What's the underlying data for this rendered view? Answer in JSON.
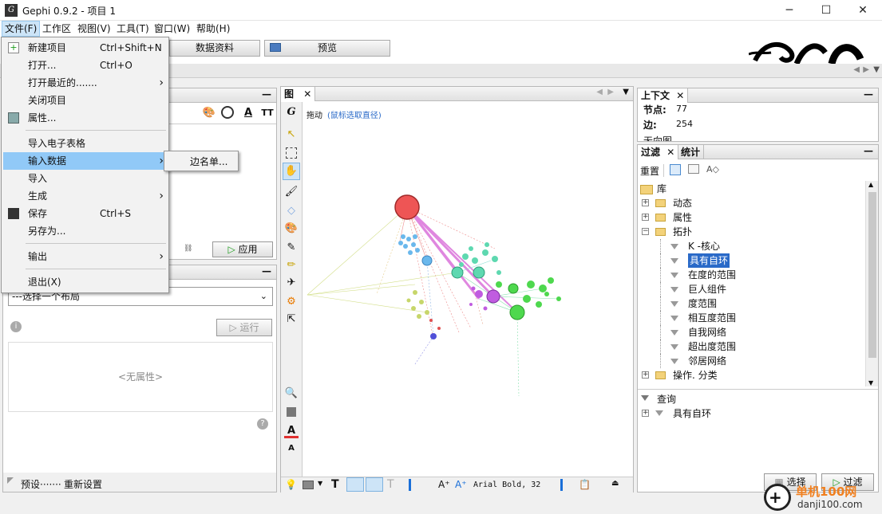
{
  "window": {
    "title": "Gephi 0.9.2 - 项目 1",
    "minimize": "─",
    "maximize": "☐",
    "close": "✕"
  },
  "menubar": [
    "文件(F)",
    "工作区",
    "视图(V)",
    "工具(T)",
    "窗口(W)",
    "帮助(H)"
  ],
  "modes": {
    "data_lab": "数据资料",
    "preview": "预览"
  },
  "file_menu": {
    "items": [
      {
        "label": "新建项目",
        "shortcut": "Ctrl+Shift+N",
        "icon": "new-project-icon"
      },
      {
        "label": "打开...",
        "shortcut": "Ctrl+O"
      },
      {
        "label": "打开最近的.......",
        "submenu": true
      },
      {
        "label": "关闭项目"
      },
      {
        "label": "属性...",
        "icon": "properties-icon"
      },
      {
        "label": "导入电子表格"
      },
      {
        "label": "输入数据",
        "submenu": true,
        "highlighted": true
      },
      {
        "label": "导入"
      },
      {
        "label": "生成",
        "submenu": true
      },
      {
        "label": "保存",
        "shortcut": "Ctrl+S",
        "icon": "save-icon"
      },
      {
        "label": "另存为..."
      },
      {
        "label": "输出",
        "submenu": true
      },
      {
        "label": "退出(X)"
      }
    ],
    "submenu_item": "边名单..."
  },
  "left_panel": {
    "apply_button": "应用",
    "layout_select": "---选择一个布局",
    "run_button": "运行",
    "no_properties": "<无属性>",
    "presets": "预设·······",
    "reset": "重新设置"
  },
  "graph_panel": {
    "tab": "图",
    "drag_hint": "拖动",
    "drag_hint_detail": "(鼠标选取直径)",
    "font_label": "Arial Bold, 32"
  },
  "context_panel": {
    "tab": "上下文",
    "nodes_label": "节点:",
    "nodes_value": "77",
    "edges_label": "边:",
    "edges_value": "254",
    "graph_type": "无向图"
  },
  "filter_panel": {
    "tabs": [
      "过滤",
      "统计"
    ],
    "reset": "重置",
    "library": "库",
    "tree": [
      {
        "label": "动态",
        "level": 1
      },
      {
        "label": "属性",
        "level": 1
      },
      {
        "label": "拓扑",
        "level": 1,
        "expanded": true
      },
      {
        "label": "K -核心",
        "level": 2
      },
      {
        "label": "具有自环",
        "level": 2,
        "selected": true
      },
      {
        "label": "在度的范围",
        "level": 2
      },
      {
        "label": "巨人组件",
        "level": 2
      },
      {
        "label": "度范围",
        "level": 2
      },
      {
        "label": "相互度范围",
        "level": 2
      },
      {
        "label": "自我网络",
        "level": 2
      },
      {
        "label": "超出度范围",
        "level": 2
      },
      {
        "label": "邻居网络",
        "level": 2
      },
      {
        "label": "操作. 分类",
        "level": 1
      }
    ],
    "queries_label": "查询",
    "query_item": "具有自环",
    "select_button": "选择",
    "filter_button": "过滤"
  },
  "watermark": {
    "site_cn": "单机100网",
    "site_url": "danji100.com"
  }
}
